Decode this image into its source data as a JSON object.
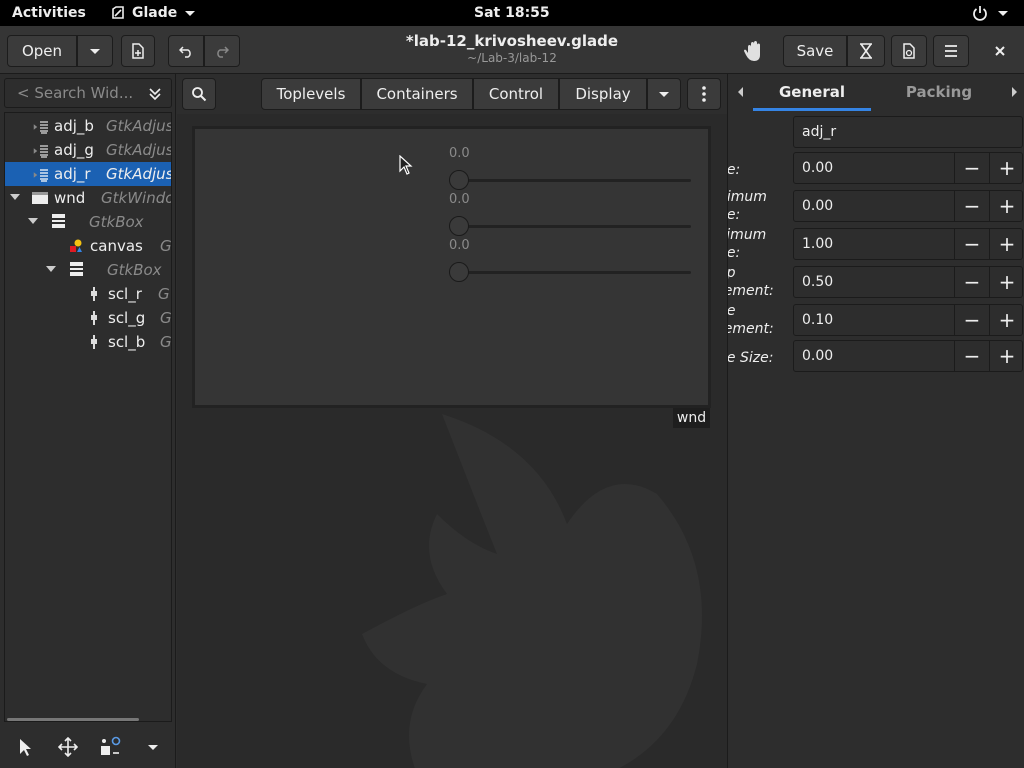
{
  "topbar": {
    "activities": "Activities",
    "app_name": "Glade",
    "clock": "Sat 18:55"
  },
  "header": {
    "open_label": "Open",
    "title": "*lab-12_krivosheev.glade",
    "subtitle": "~/Lab-3/lab-12",
    "save_label": "Save"
  },
  "search": {
    "placeholder": "< Search Wid..."
  },
  "tree": [
    {
      "name": "adj_b",
      "type": "GtkAdjus"
    },
    {
      "name": "adj_g",
      "type": "GtkAdjus"
    },
    {
      "name": "adj_r",
      "type": "GtkAdjus"
    },
    {
      "name": "wnd",
      "type": "GtkWindo"
    },
    {
      "name": "",
      "type": "GtkBox"
    },
    {
      "name": "canvas",
      "type": "G"
    },
    {
      "name": "",
      "type": "GtkBox"
    },
    {
      "name": "scl_r",
      "type": "G"
    },
    {
      "name": "scl_g",
      "type": "G"
    },
    {
      "name": "scl_b",
      "type": "G"
    }
  ],
  "palette": {
    "tabs": [
      "Toplevels",
      "Containers",
      "Control",
      "Display"
    ]
  },
  "design": {
    "window_label": "wnd",
    "scales": [
      {
        "value": "0.0"
      },
      {
        "value": "0.0"
      },
      {
        "value": "0.0"
      }
    ]
  },
  "editor": {
    "tabs": [
      "General",
      "Packing"
    ],
    "name_value": "adj_r",
    "props": [
      {
        "label_lines": [
          "ue:"
        ],
        "value": "0.00"
      },
      {
        "label_lines": [
          "nimum",
          "ue:"
        ],
        "value": "0.00"
      },
      {
        "label_lines": [
          "ximum",
          "ue:"
        ],
        "value": "1.00"
      },
      {
        "label_lines": [
          "ep",
          "rement:"
        ],
        "value": "0.50"
      },
      {
        "label_lines": [
          "ge",
          "rement:"
        ],
        "value": "0.10"
      },
      {
        "label_lines": [
          "ge Size:"
        ],
        "value": "0.00"
      }
    ]
  },
  "colors": {
    "selection": "#1b61b3",
    "accent_underline": "#3584e4",
    "bg": "#2d2d2d"
  }
}
